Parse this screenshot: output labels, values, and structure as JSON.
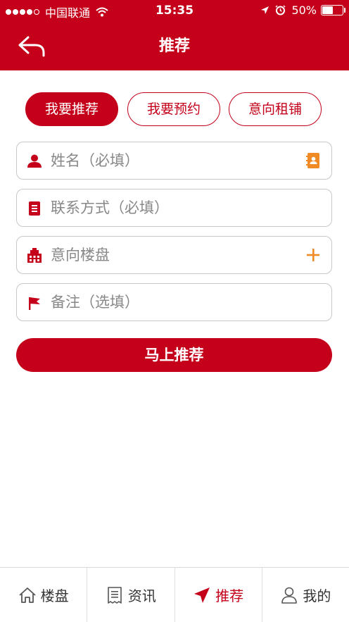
{
  "status_bar": {
    "carrier": "中国联通",
    "time": "15:35",
    "battery_text": "50%",
    "battery_level": 0.5,
    "signal_bars_filled": 4,
    "signal_bars_total": 5
  },
  "nav": {
    "title": "推荐",
    "back_icon": "back-arrow-icon"
  },
  "tabs": [
    {
      "label": "我要推荐",
      "active": true
    },
    {
      "label": "我要预约",
      "active": false
    },
    {
      "label": "意向租铺",
      "active": false
    }
  ],
  "form": {
    "name_placeholder": "姓名（必填）",
    "contact_placeholder": "联系方式（必填）",
    "property_placeholder": "意向楼盘",
    "remark_placeholder": "备注（选填）"
  },
  "submit_label": "马上推荐",
  "tabbar": [
    {
      "label": "楼盘",
      "icon": "home-icon",
      "active": false
    },
    {
      "label": "资讯",
      "icon": "news-icon",
      "active": false
    },
    {
      "label": "推荐",
      "icon": "send-icon",
      "active": true
    },
    {
      "label": "我的",
      "icon": "user-icon",
      "active": false
    }
  ],
  "colors": {
    "brand": "#c4001a",
    "accent_orange": "#f08a24",
    "border": "#c8c8c8"
  }
}
